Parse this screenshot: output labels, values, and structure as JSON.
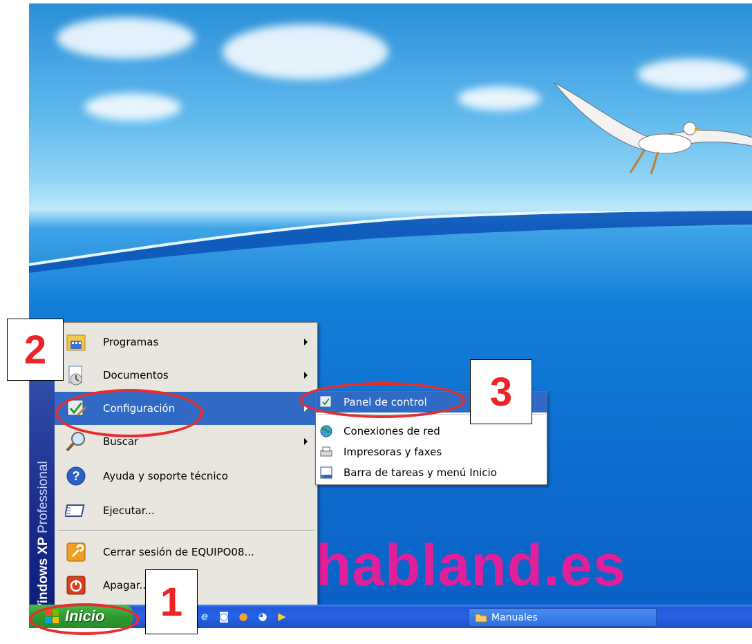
{
  "watermark": "habland.es",
  "os_banner": {
    "brand": "Windows XP",
    "edition": "Professional"
  },
  "start_menu": {
    "items": [
      {
        "label": "Programas",
        "icon": "programs-icon",
        "submenu": true
      },
      {
        "label": "Documentos",
        "icon": "documents-icon",
        "submenu": true
      },
      {
        "label": "Configuración",
        "icon": "settings-icon",
        "submenu": true,
        "highlighted": true
      },
      {
        "label": "Buscar",
        "icon": "search-icon",
        "submenu": true
      },
      {
        "label": "Ayuda y soporte técnico",
        "icon": "help-icon",
        "submenu": false
      },
      {
        "label": "Ejecutar...",
        "icon": "run-icon",
        "submenu": false
      },
      {
        "label": "Cerrar sesión de EQUIPO08...",
        "icon": "logoff-icon",
        "submenu": false
      },
      {
        "label": "Apagar...",
        "icon": "shutdown-icon",
        "submenu": false
      }
    ]
  },
  "submenu": {
    "items": [
      {
        "label": "Panel de control",
        "icon": "control-panel-icon",
        "highlighted": true
      },
      {
        "label": "Conexiones de red",
        "icon": "network-icon"
      },
      {
        "label": "Impresoras y faxes",
        "icon": "printer-icon"
      },
      {
        "label": "Barra de tareas y menú Inicio",
        "icon": "taskbar-icon"
      }
    ]
  },
  "taskbar": {
    "start_label": "Inicio",
    "window_button": "Manuales",
    "quick_launch": [
      "internet-explorer-icon",
      "media-icon",
      "firefox-icon",
      "messenger-icon",
      "media-player-icon"
    ]
  },
  "annotations": {
    "step1": "1",
    "step2": "2",
    "step3": "3"
  },
  "colors": {
    "highlight": "#316ac5",
    "annotation": "#ef2323",
    "watermark": "#e0209a"
  }
}
